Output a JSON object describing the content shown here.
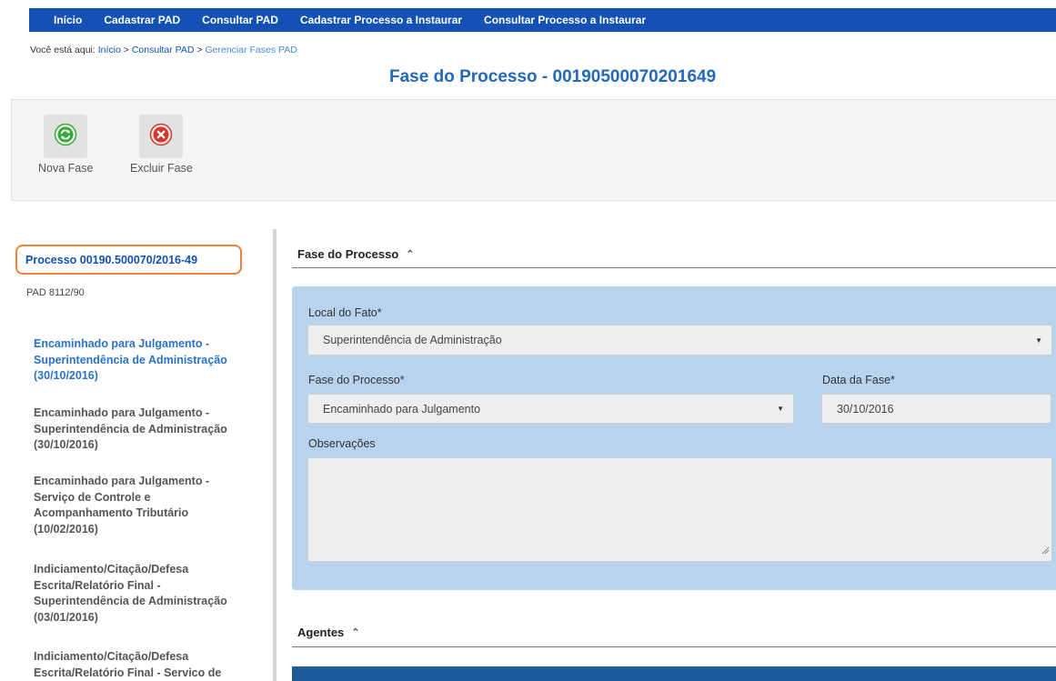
{
  "nav": {
    "items": [
      "Início",
      "Cadastrar PAD",
      "Consultar PAD",
      "Cadastrar Processo a Instaurar",
      "Consultar Processo a Instaurar"
    ]
  },
  "breadcrumb": {
    "prefix": "Você está aqui:",
    "link1": "Início",
    "sep": ">",
    "link2": "Consultar PAD",
    "current": "Gerenciar Fases PAD"
  },
  "page_title": "Fase do Processo - 00190500070201649",
  "toolbar": {
    "new_phase_label": "Nova Fase",
    "delete_phase_label": "Excluir Fase",
    "new_icon": "refresh-circle-icon",
    "delete_icon": "x-circle-icon"
  },
  "sidebar": {
    "process_link": "Processo 00190.500070/2016-49",
    "pad_label": "PAD 8112/90",
    "phases": [
      [
        "Encaminhado para Julgamento -",
        "Superintendência de Administração",
        "(30/10/2016)"
      ],
      [
        "Encaminhado para Julgamento -",
        "Superintendência de Administração",
        "(30/10/2016)"
      ],
      [
        "Encaminhado para Julgamento -",
        "Serviço de Controle e",
        "Acompanhamento Tributário",
        "(10/02/2016)"
      ],
      [
        "Indiciamento/Citação/Defesa",
        "Escrita/Relatório Final -",
        "Superintendência de Administração",
        "(03/01/2016)"
      ],
      [
        "Indiciamento/Citação/Defesa",
        "Escrita/Relatório Final - Servico de"
      ]
    ]
  },
  "form": {
    "section_title": "Fase do Processo",
    "local_label": "Local do Fato*",
    "local_value": "Superintendência de Administração",
    "fase_label": "Fase do Processo*",
    "fase_value": "Encaminhado para Julgamento",
    "data_label": "Data da Fase*",
    "data_value": "30/10/2016",
    "obs_label": "Observações",
    "obs_value": ""
  },
  "agents": {
    "section_title": "Agentes"
  },
  "colors": {
    "nav_bg": "#1351b4",
    "title": "#2469b9",
    "highlight": "#f0823a",
    "panel": "#b7d3ee",
    "active_phase": "#2a72c5"
  }
}
